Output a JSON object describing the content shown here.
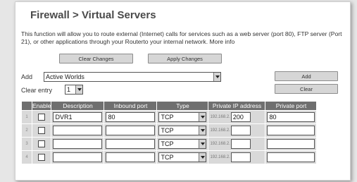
{
  "page": {
    "title": "Firewall > Virtual Servers",
    "description": "This function will allow you to route external (Internet) calls for services such as a web server (port 80), FTP server (Port 21), or other applications through your Routerto your internal network. More info"
  },
  "buttons": {
    "clear_changes": "Clear Changes",
    "apply_changes": "Apply Changes",
    "add": "Add",
    "clear": "Clear"
  },
  "add_row": {
    "label": "Add",
    "selected": "Active Worlds"
  },
  "clear_entry": {
    "label": "Clear entry",
    "selected": "1"
  },
  "table": {
    "headers": [
      "Enable",
      "Description",
      "Inbound port",
      "Type",
      "Private IP address",
      "Private port"
    ],
    "rows": [
      {
        "num": "1",
        "description": "DVR1",
        "inbound": "80",
        "type": "TCP",
        "ip_prefix": "192.168.2.",
        "ip_last": "200",
        "private_port": "80"
      },
      {
        "num": "2",
        "description": "",
        "inbound": "",
        "type": "TCP",
        "ip_prefix": "192.168.2.",
        "ip_last": "",
        "private_port": ""
      },
      {
        "num": "3",
        "description": "",
        "inbound": "",
        "type": "TCP",
        "ip_prefix": "192.168.2.",
        "ip_last": "",
        "private_port": ""
      },
      {
        "num": "4",
        "description": "",
        "inbound": "",
        "type": "TCP",
        "ip_prefix": "192.168.2.",
        "ip_last": "",
        "private_port": ""
      }
    ]
  }
}
